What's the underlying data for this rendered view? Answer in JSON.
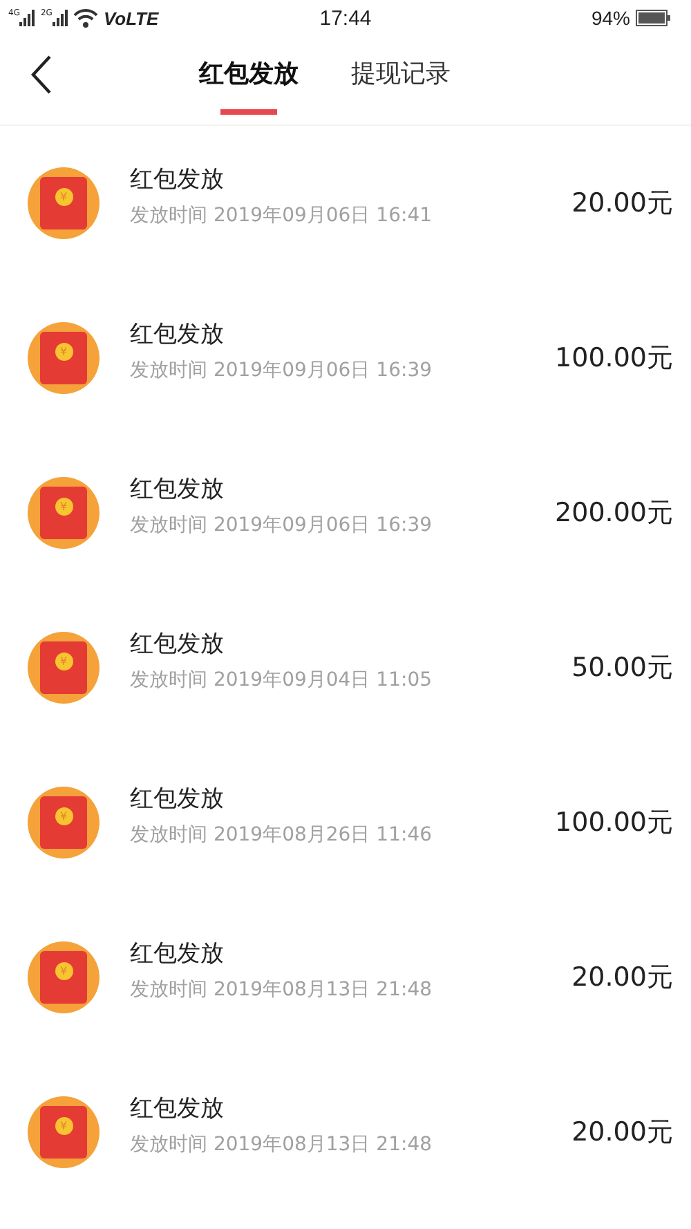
{
  "status_bar": {
    "network_1": "4G",
    "network_2": "2G",
    "volte": "VoLTE",
    "time": "17:44",
    "battery": "94%"
  },
  "tabs": [
    {
      "label": "红包发放",
      "selected": true
    },
    {
      "label": "提现记录",
      "selected": false
    }
  ],
  "records": [
    {
      "icon_symbol": "¥",
      "title": "红包发放",
      "time": "发放时间 2019年09月06日 16:41",
      "amount": "20.00元"
    },
    {
      "icon_symbol": "¥",
      "title": "红包发放",
      "time": "发放时间 2019年09月06日 16:39",
      "amount": "100.00元"
    },
    {
      "icon_symbol": "¥",
      "title": "红包发放",
      "time": "发放时间 2019年09月06日 16:39",
      "amount": "200.00元"
    },
    {
      "icon_symbol": "¥",
      "title": "红包发放",
      "time": "发放时间 2019年09月04日 11:05",
      "amount": "50.00元"
    },
    {
      "icon_symbol": "¥",
      "title": "红包发放",
      "time": "发放时间 2019年08月26日 11:46",
      "amount": "100.00元"
    },
    {
      "icon_symbol": "¥",
      "title": "红包发放",
      "time": "发放时间 2019年08月13日 21:48",
      "amount": "20.00元"
    },
    {
      "icon_symbol": "¥",
      "title": "红包发放",
      "time": "发放时间 2019年08月13日 21:48",
      "amount": "20.00元"
    }
  ]
}
